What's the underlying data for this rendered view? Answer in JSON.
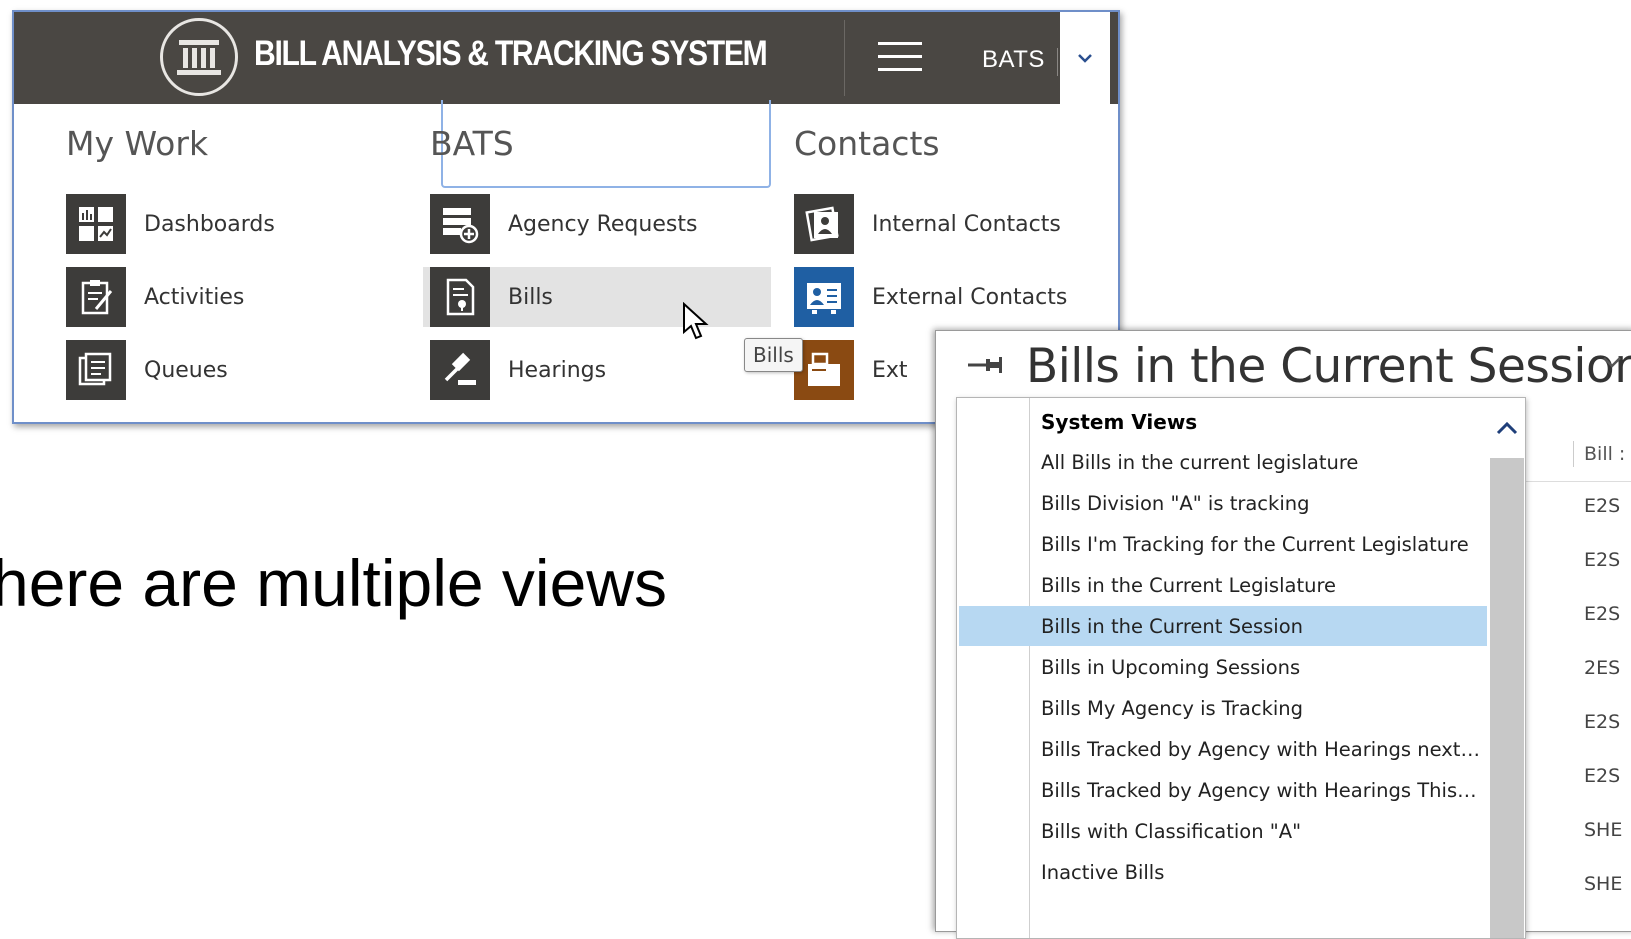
{
  "app": {
    "title": "BILL ANALYSIS & TRACKING SYSTEM",
    "area": "BATS"
  },
  "columns": {
    "my_work": {
      "title": "My Work",
      "items": [
        {
          "label": "Dashboards",
          "icon": "dashboard-icon"
        },
        {
          "label": "Activities",
          "icon": "clipboard-icon"
        },
        {
          "label": "Queues",
          "icon": "queue-icon"
        }
      ]
    },
    "bats": {
      "title": "BATS",
      "items": [
        {
          "label": "Agency Requests",
          "icon": "agency-request-icon"
        },
        {
          "label": "Bills",
          "icon": "bill-document-icon"
        },
        {
          "label": "Hearings",
          "icon": "gavel-icon"
        }
      ]
    },
    "contacts": {
      "title": "Contacts",
      "items": [
        {
          "label": "Internal Contacts",
          "icon": "internal-contact-icon"
        },
        {
          "label": "External Contacts",
          "icon": "external-contact-icon"
        },
        {
          "label": "Ext",
          "icon": "folder-contact-icon"
        }
      ]
    }
  },
  "tooltip": "Bills",
  "caption": "here are multiple views",
  "view_selector": {
    "title": "Bills in the Current Session",
    "section_header": "System Views",
    "items": [
      "All Bills in the current legislature",
      "Bills Division \"A\" is tracking",
      "Bills I'm Tracking for the Current Legislature",
      "Bills in the Current Legislature",
      "Bills in the Current Session",
      "Bills in Upcoming Sessions",
      "Bills My Agency is Tracking",
      "Bills Tracked by Agency with Hearings next week",
      "Bills Tracked by Agency with Hearings This Week...",
      "Bills with Classification \"A\"",
      "Inactive Bills"
    ],
    "selected": "Bills in the Current Session"
  },
  "grid": {
    "column_header": "Bill :",
    "cells": [
      "E2S",
      "E2S",
      "E2S",
      "2ES",
      "E2S",
      "E2S",
      "SHE",
      "SHE"
    ]
  },
  "colors": {
    "topbar": "#4a4743",
    "tile": "#3d3c3a",
    "external_contacts_tile": "#1f5fa3",
    "folder_tile": "#8a4a12",
    "selected_row": "#b7d8f2",
    "focus_border": "#8fb2e6"
  }
}
